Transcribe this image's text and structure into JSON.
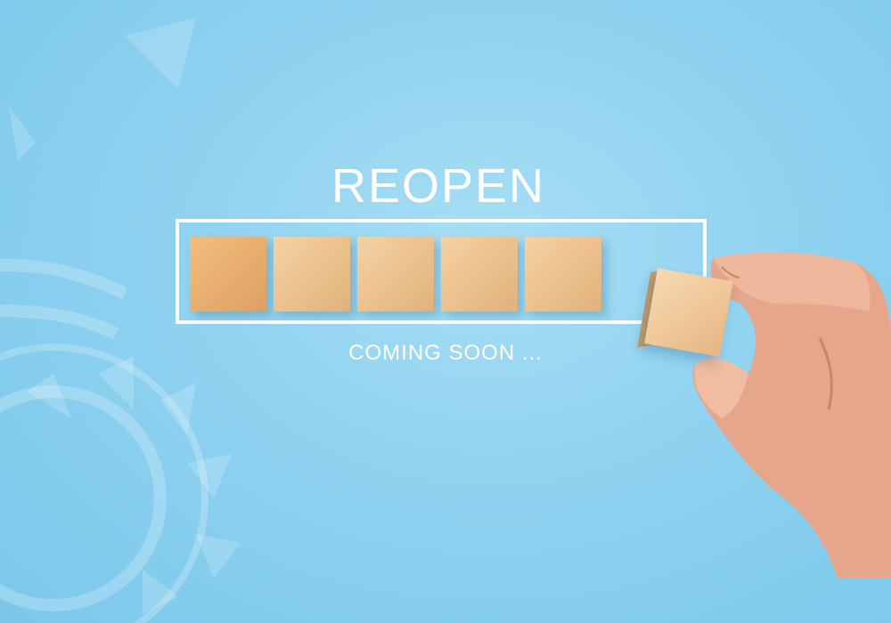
{
  "headline": "REOPEN",
  "subline": "COMING SOON ...",
  "progress": {
    "filled_blocks": 5,
    "total_blocks": 6
  },
  "colors": {
    "background": "#8fd2f0",
    "text": "#ffffff",
    "frame": "#ffffff",
    "wood": "#ebc08c",
    "skin": "#e9a98e"
  }
}
